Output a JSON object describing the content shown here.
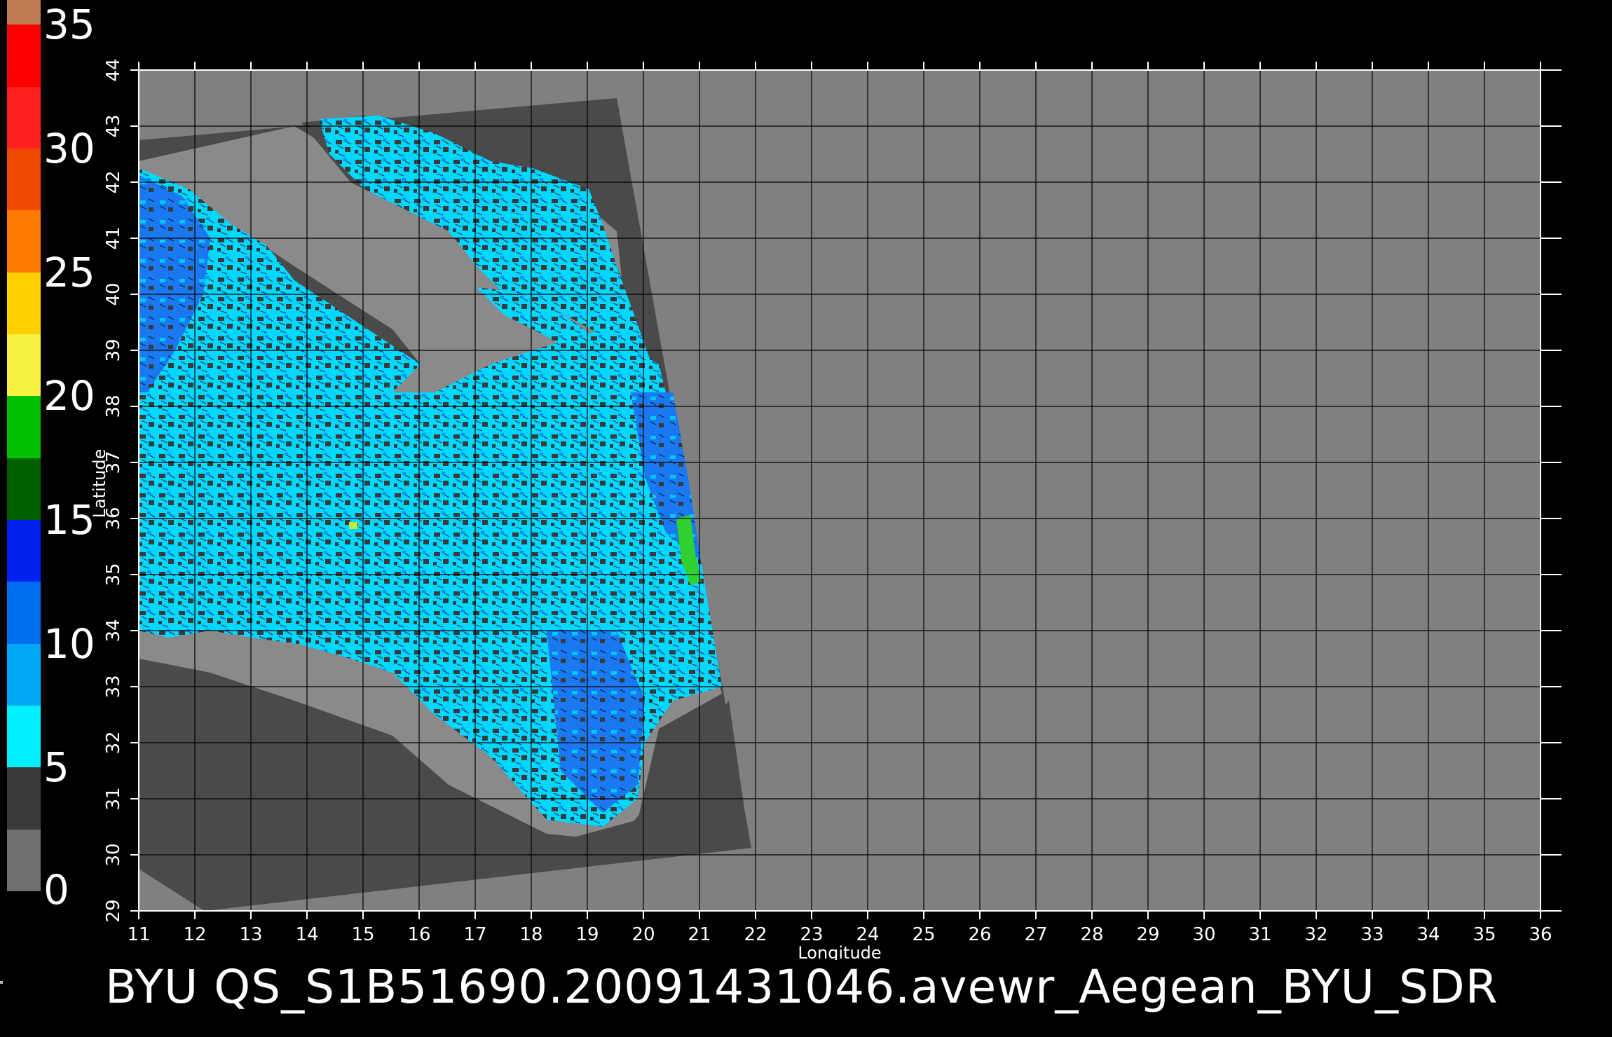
{
  "title": "BYU  QS_S1B51690.20091431046.avewr_Aegean_BYU_SDR",
  "colorbar": {
    "labels": [
      "0",
      "5",
      "10",
      "15",
      "20",
      "25",
      "30",
      "35"
    ],
    "segments": [
      {
        "from": 0,
        "to": 2.5,
        "color": "#707070"
      },
      {
        "from": 2.5,
        "to": 5,
        "color": "#3a3a3a"
      },
      {
        "from": 5,
        "to": 7.5,
        "color": "#00f0ff"
      },
      {
        "from": 7.5,
        "to": 10,
        "color": "#00a8f8"
      },
      {
        "from": 10,
        "to": 12.5,
        "color": "#0070f0"
      },
      {
        "from": 12.5,
        "to": 15,
        "color": "#0020f0"
      },
      {
        "from": 15,
        "to": 17.5,
        "color": "#006000"
      },
      {
        "from": 17.5,
        "to": 20,
        "color": "#00c000"
      },
      {
        "from": 20,
        "to": 22.5,
        "color": "#f8f040"
      },
      {
        "from": 22.5,
        "to": 25,
        "color": "#ffd000"
      },
      {
        "from": 25,
        "to": 27.5,
        "color": "#ff7a00"
      },
      {
        "from": 27.5,
        "to": 30,
        "color": "#f04800"
      },
      {
        "from": 30,
        "to": 32.5,
        "color": "#ff2020"
      },
      {
        "from": 32.5,
        "to": 35,
        "color": "#ff0000"
      },
      {
        "from": 35,
        "to": 36,
        "color": "#c07850"
      }
    ]
  },
  "chart_data": {
    "type": "heatmap",
    "title": "BYU  QS_S1B51690.20091431046.avewr_Aegean_BYU_SDR",
    "xlabel": "Longitude",
    "ylabel": "Latitude",
    "xlim": [
      11,
      36
    ],
    "ylim": [
      29,
      44
    ],
    "x_ticks": [
      "11",
      "12",
      "13",
      "14",
      "15",
      "16",
      "17",
      "18",
      "19",
      "20",
      "21",
      "22",
      "23",
      "24",
      "25",
      "26",
      "27",
      "28",
      "29",
      "30",
      "31",
      "32",
      "33",
      "34",
      "35",
      "36"
    ],
    "y_ticks": [
      "29",
      "30",
      "31",
      "32",
      "33",
      "34",
      "35",
      "36",
      "37",
      "38",
      "39",
      "40",
      "41",
      "42",
      "43",
      "44"
    ],
    "grid": true,
    "colorbar_range": [
      0,
      35
    ],
    "colors": {
      "background": "#808080",
      "swath": "#4a4a4a",
      "coast_buffer": "#8a8a8a",
      "wind_low": "#00e8ff",
      "wind_mid": "#0080f0",
      "wind_high": "#00c000",
      "grid": "#000000"
    }
  }
}
